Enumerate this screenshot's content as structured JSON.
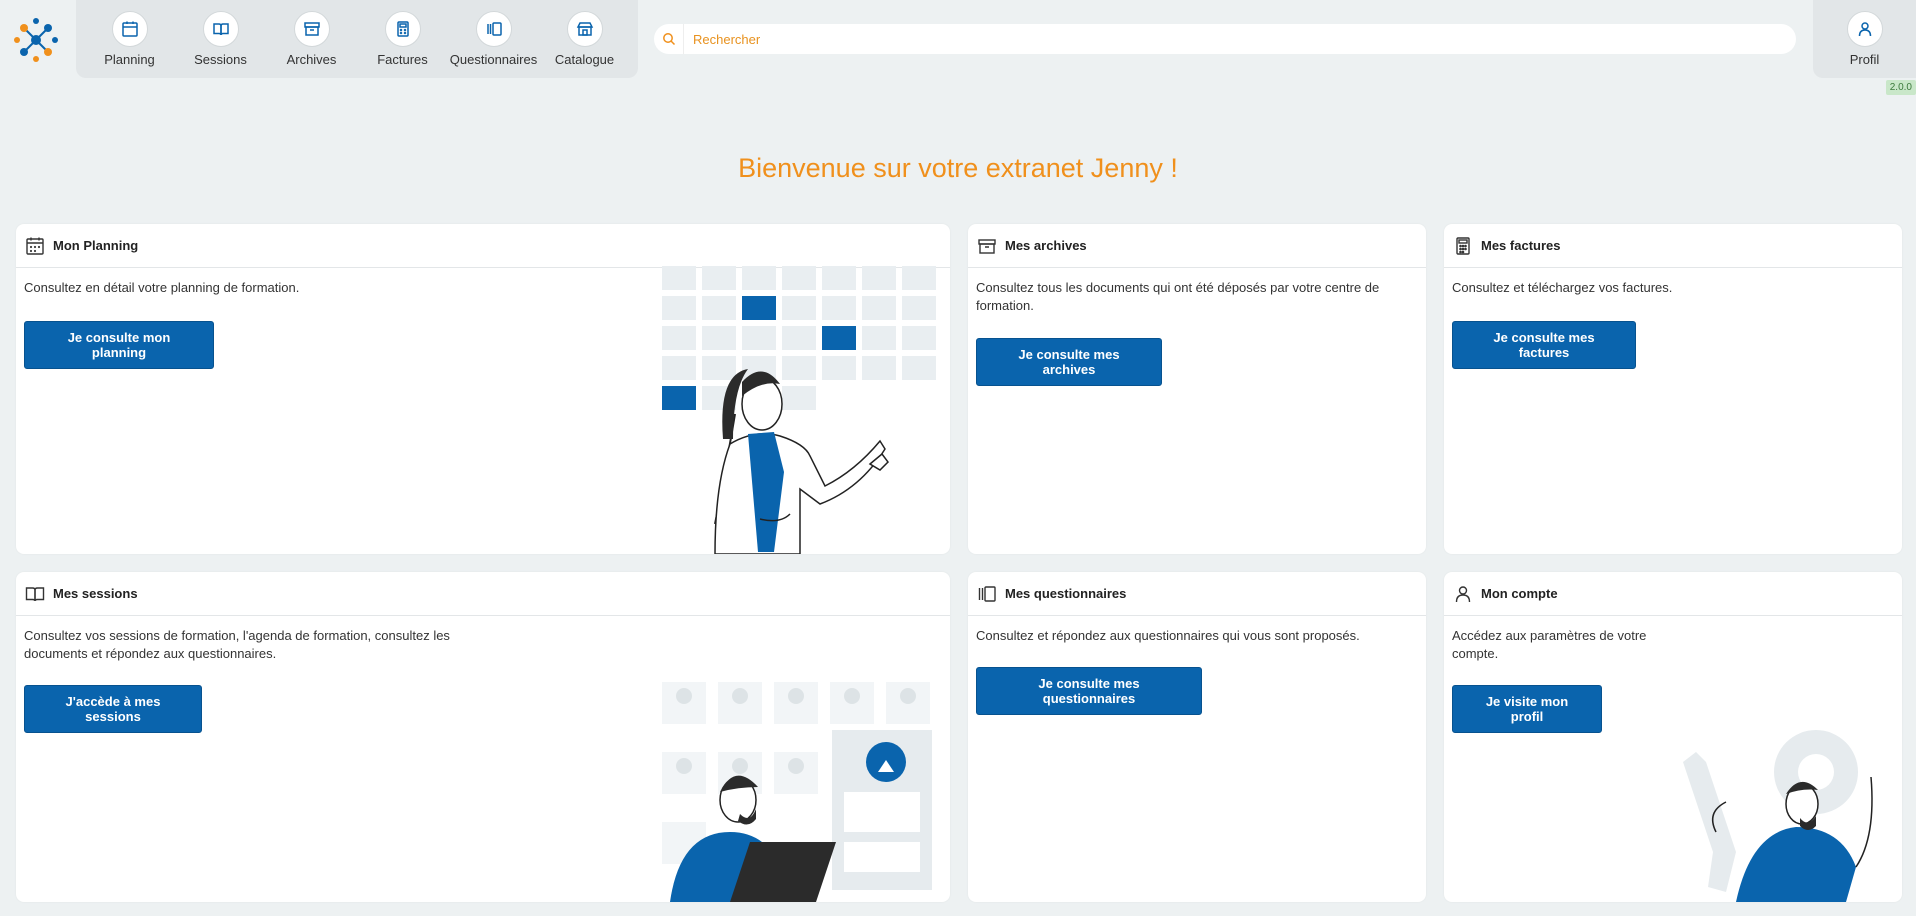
{
  "nav": {
    "items": [
      {
        "label": "Planning",
        "icon": "calendar-icon"
      },
      {
        "label": "Sessions",
        "icon": "book-icon"
      },
      {
        "label": "Archives",
        "icon": "archive-icon"
      },
      {
        "label": "Factures",
        "icon": "calculator-icon"
      },
      {
        "label": "Questionnaires",
        "icon": "list-icon"
      },
      {
        "label": "Catalogue",
        "icon": "store-icon"
      }
    ]
  },
  "search": {
    "placeholder": "Rechercher"
  },
  "profile": {
    "label": "Profil"
  },
  "version": "2.0.0",
  "welcome": "Bienvenue sur votre extranet Jenny !",
  "cards": {
    "planning": {
      "title": "Mon Planning",
      "text": "Consultez en détail votre planning de formation.",
      "button": "Je consulte mon planning"
    },
    "archives": {
      "title": "Mes archives",
      "text": "Consultez tous les documents qui ont été déposés par votre centre de formation.",
      "button": "Je consulte mes archives"
    },
    "factures": {
      "title": "Mes factures",
      "text": "Consultez et téléchargez vos factures.",
      "button": "Je consulte mes factures"
    },
    "sessions": {
      "title": "Mes sessions",
      "text": "Consultez vos sessions de formation, l'agenda de formation, consultez les documents et répondez aux questionnaires.",
      "button": "J'accède à mes sessions"
    },
    "questionnaires": {
      "title": "Mes questionnaires",
      "text": "Consultez et répondez aux questionnaires qui vous sont proposés.",
      "button": "Je consulte mes questionnaires"
    },
    "compte": {
      "title": "Mon compte",
      "text": "Accédez aux paramètres de votre compte.",
      "button": "Je visite mon profil"
    }
  },
  "colors": {
    "accent": "#0a64ad",
    "welcome": "#f0901c",
    "background": "#edf1f2"
  }
}
